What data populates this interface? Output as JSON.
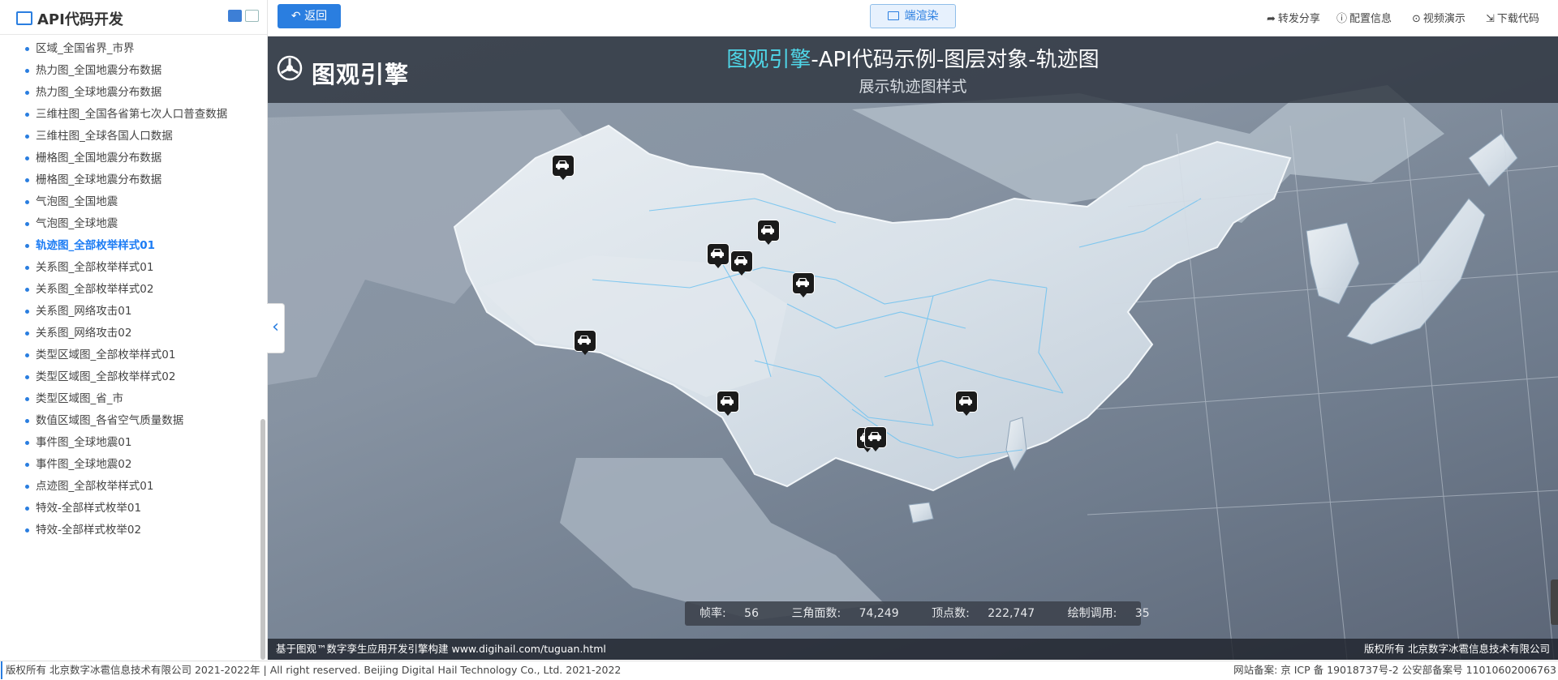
{
  "sidebar": {
    "title": "API代码开发",
    "items": [
      {
        "label": "区域_全国省界_市界",
        "active": false
      },
      {
        "label": "热力图_全国地震分布数据",
        "active": false
      },
      {
        "label": "热力图_全球地震分布数据",
        "active": false
      },
      {
        "label": "三维柱图_全国各省第七次人口普查数据",
        "active": false
      },
      {
        "label": "三维柱图_全球各国人口数据",
        "active": false
      },
      {
        "label": "栅格图_全国地震分布数据",
        "active": false
      },
      {
        "label": "栅格图_全球地震分布数据",
        "active": false
      },
      {
        "label": "气泡图_全国地震",
        "active": false
      },
      {
        "label": "气泡图_全球地震",
        "active": false
      },
      {
        "label": "轨迹图_全部枚举样式01",
        "active": true
      },
      {
        "label": "关系图_全部枚举样式01",
        "active": false
      },
      {
        "label": "关系图_全部枚举样式02",
        "active": false
      },
      {
        "label": "关系图_网络攻击01",
        "active": false
      },
      {
        "label": "关系图_网络攻击02",
        "active": false
      },
      {
        "label": "类型区域图_全部枚举样式01",
        "active": false
      },
      {
        "label": "类型区域图_全部枚举样式02",
        "active": false
      },
      {
        "label": "类型区域图_省_市",
        "active": false
      },
      {
        "label": "数值区域图_各省空气质量数据",
        "active": false
      },
      {
        "label": "事件图_全球地震01",
        "active": false
      },
      {
        "label": "事件图_全球地震02",
        "active": false
      },
      {
        "label": "点迹图_全部枚举样式01",
        "active": false
      },
      {
        "label": "特效-全部样式枚举01",
        "active": false
      },
      {
        "label": "特效-全部样式枚举02",
        "active": false
      }
    ]
  },
  "toolbar": {
    "back_label": "返回",
    "render_label": "端渲染",
    "share_label": "转发分享",
    "config_label": "配置信息",
    "video_label": "视频演示",
    "download_label": "下载代码"
  },
  "map": {
    "logo_text": "图观引擎",
    "title_highlight": "图观引擎",
    "title_rest": "-API代码示例-图层对象-轨迹图",
    "subtitle": "展示轨迹图样式",
    "stats": {
      "fps_label": "帧率:",
      "fps": "56",
      "triangles_label": "三角面数:",
      "triangles": "74,249",
      "vertices_label": "顶点数:",
      "vertices": "222,747",
      "drawcalls_label": "绘制调用:",
      "drawcalls": "35"
    },
    "footer_left": "基于图观™数字孪生应用开发引擎构建 www.digihail.com/tuguan.html",
    "footer_right": "版权所有 北京数字冰雹信息技术有限公司",
    "vehicle_count": 10
  },
  "page_footer": {
    "left": "版权所有 北京数字冰雹信息技术有限公司 2021-2022年 | All right reserved. Beijing Digital Hail Technology Co., Ltd. 2021-2022",
    "right": "网站备案: 京 ICP 备 19018737号-2 公安部备案号 11010602006763"
  },
  "colors": {
    "accent": "#2a7ee0",
    "title_highlight": "#4fd6e8",
    "map_land": "#dde5ec",
    "map_sea": "#7e8a99"
  },
  "icons": [
    "terminal-icon",
    "grid-view-icon",
    "image-view-icon",
    "arrow-back-icon",
    "monitor-icon",
    "share-icon",
    "info-icon",
    "play-icon",
    "download-icon",
    "chevron-left-icon",
    "car-icon"
  ]
}
